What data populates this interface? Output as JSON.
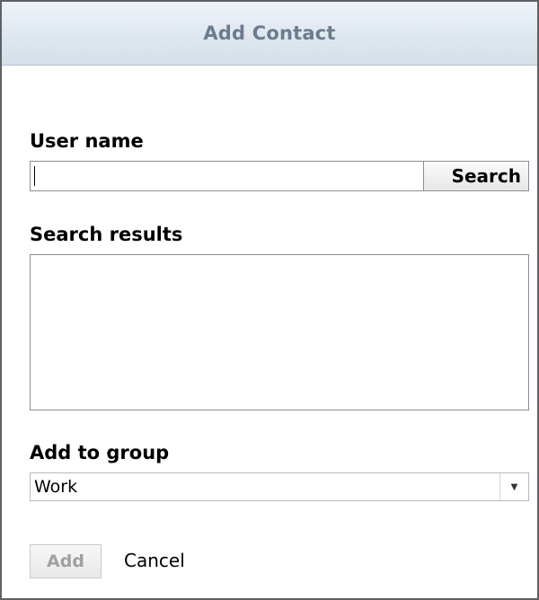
{
  "dialog": {
    "title": "Add Contact"
  },
  "username": {
    "label": "User name",
    "value": "",
    "search_button": "Search"
  },
  "results": {
    "label": "Search results",
    "items": []
  },
  "group": {
    "label": "Add to group",
    "selected": "Work",
    "dropdown_icon": "triangle-down-icon"
  },
  "actions": {
    "add_label": "Add",
    "add_enabled": false,
    "cancel_label": "Cancel"
  },
  "colors": {
    "title_text": "#6b7c8e",
    "title_bar": "#dde6ef",
    "border": "#5f6163",
    "disabled_text": "#a0a0a0"
  }
}
